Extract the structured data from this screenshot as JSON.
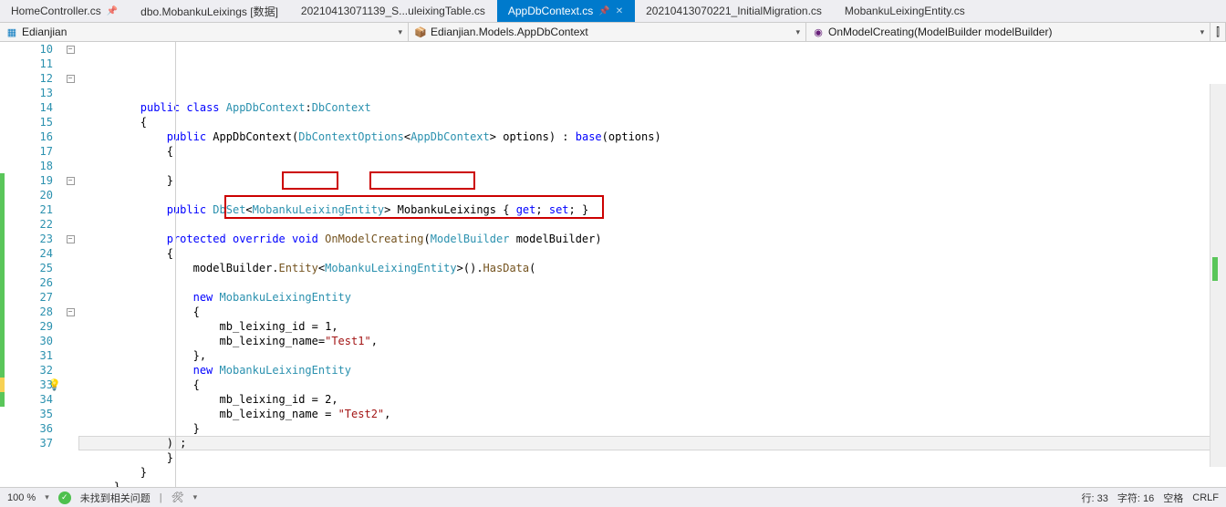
{
  "tabs": [
    {
      "label": "HomeController.cs",
      "pinned": true,
      "active": false
    },
    {
      "label": "dbo.MobankuLeixings [数据]",
      "pinned": false,
      "active": false
    },
    {
      "label": "20210413071139_S...uleixingTable.cs",
      "pinned": false,
      "active": false
    },
    {
      "label": "AppDbContext.cs",
      "pinned": true,
      "active": true
    },
    {
      "label": "20210413070221_InitialMigration.cs",
      "pinned": false,
      "active": false
    },
    {
      "label": "MobankuLeixingEntity.cs",
      "pinned": false,
      "active": false
    }
  ],
  "nav": {
    "project": "Edianjian",
    "type": "Edianjian.Models.AppDbContext",
    "member": "OnModelCreating(ModelBuilder modelBuilder)"
  },
  "lines": {
    "10": [
      [
        "kw",
        "public"
      ],
      [
        "",
        ""
      ],
      [
        "kw",
        "class"
      ],
      [
        "",
        ""
      ],
      [
        "type",
        "AppDbContext"
      ],
      [
        "punct",
        ":"
      ],
      [
        "type",
        "DbContext"
      ]
    ],
    "11": [
      [
        "punct",
        "{"
      ]
    ],
    "12": [
      [
        "kw",
        "public"
      ],
      [
        "",
        ""
      ],
      [
        "ident",
        "AppDbContext"
      ],
      [
        "punct",
        "("
      ],
      [
        "type",
        "DbContextOptions"
      ],
      [
        "punct",
        "<"
      ],
      [
        "type",
        "AppDbContext"
      ],
      [
        "punct",
        ">"
      ],
      [
        "",
        ""
      ],
      [
        "ident",
        "options"
      ],
      [
        "punct",
        ")"
      ],
      [
        "",
        ""
      ],
      [
        "punct",
        ":"
      ],
      [
        "",
        ""
      ],
      [
        "kw",
        "base"
      ],
      [
        "punct",
        "("
      ],
      [
        "ident",
        "options"
      ],
      [
        "punct",
        ")"
      ]
    ],
    "13": [
      [
        "punct",
        "{"
      ]
    ],
    "14": [],
    "15": [
      [
        "punct",
        "}"
      ]
    ],
    "16": [],
    "17": [
      [
        "kw",
        "public"
      ],
      [
        "",
        ""
      ],
      [
        "type",
        "DbSet"
      ],
      [
        "punct",
        "<"
      ],
      [
        "type",
        "MobankuLeixingEntity"
      ],
      [
        "punct",
        ">"
      ],
      [
        "",
        ""
      ],
      [
        "ident",
        "MobankuLeixings"
      ],
      [
        "",
        ""
      ],
      [
        "punct",
        "{"
      ],
      [
        "",
        ""
      ],
      [
        "kw",
        "get"
      ],
      [
        "punct",
        ";"
      ],
      [
        "",
        ""
      ],
      [
        "kw",
        "set"
      ],
      [
        "punct",
        ";"
      ],
      [
        "",
        ""
      ],
      [
        "punct",
        "}"
      ]
    ],
    "18": [],
    "19": [
      [
        "kw",
        "protected"
      ],
      [
        "",
        ""
      ],
      [
        "kw",
        "override"
      ],
      [
        "",
        ""
      ],
      [
        "kw",
        "void"
      ],
      [
        "",
        ""
      ],
      [
        "method",
        "OnModelCreating"
      ],
      [
        "punct",
        "("
      ],
      [
        "type",
        "ModelBuilder"
      ],
      [
        "",
        ""
      ],
      [
        "ident",
        "modelBuilder"
      ],
      [
        "punct",
        ")"
      ]
    ],
    "20": [
      [
        "punct",
        "{"
      ]
    ],
    "21": [
      [
        "ident",
        "modelBuilder"
      ],
      [
        "punct",
        "."
      ],
      [
        "method",
        "Entity"
      ],
      [
        "punct",
        "<"
      ],
      [
        "type",
        "MobankuLeixingEntity"
      ],
      [
        "punct",
        ">"
      ],
      [
        "punct",
        "()"
      ],
      [
        "punct",
        "."
      ],
      [
        "method",
        "HasData"
      ],
      [
        "punct",
        "("
      ]
    ],
    "22": [],
    "23": [
      [
        "kw",
        "new"
      ],
      [
        "",
        ""
      ],
      [
        "type",
        "MobankuLeixingEntity"
      ]
    ],
    "24": [
      [
        "punct",
        "{"
      ]
    ],
    "25": [
      [
        "ident",
        "mb_leixing_id"
      ],
      [
        "",
        ""
      ],
      [
        "punct",
        "="
      ],
      [
        "",
        ""
      ],
      [
        "num",
        "1"
      ],
      [
        "punct",
        ","
      ]
    ],
    "26": [
      [
        "ident",
        "mb_leixing_name"
      ],
      [
        "punct",
        "="
      ],
      [
        "str",
        "\"Test1\""
      ],
      [
        "punct",
        ","
      ]
    ],
    "27": [
      [
        "punct",
        "},"
      ]
    ],
    "28": [
      [
        "kw",
        "new"
      ],
      [
        "",
        ""
      ],
      [
        "type",
        "MobankuLeixingEntity"
      ]
    ],
    "29": [
      [
        "punct",
        "{"
      ]
    ],
    "30": [
      [
        "ident",
        "mb_leixing_id"
      ],
      [
        "",
        ""
      ],
      [
        "punct",
        "="
      ],
      [
        "",
        ""
      ],
      [
        "num",
        "2"
      ],
      [
        "punct",
        ","
      ]
    ],
    "31": [
      [
        "ident",
        "mb_leixing_name"
      ],
      [
        "",
        ""
      ],
      [
        "punct",
        "="
      ],
      [
        "",
        ""
      ],
      [
        "str",
        "\"Test2\""
      ],
      [
        "punct",
        ","
      ]
    ],
    "32": [
      [
        "punct",
        "}"
      ]
    ],
    "33": [
      [
        "punct",
        ") ;"
      ]
    ],
    "34": [
      [
        "punct",
        "}"
      ]
    ],
    "35": [
      [
        "punct",
        "}"
      ]
    ],
    "36": [
      [
        "punct",
        "}"
      ]
    ],
    "37": []
  },
  "indent": {
    "10": 2,
    "11": 2,
    "12": 3,
    "13": 3,
    "14": 0,
    "15": 3,
    "16": 0,
    "17": 3,
    "18": 0,
    "19": 3,
    "20": 3,
    "21": 4,
    "22": 0,
    "23": 4,
    "24": 4,
    "25": 5,
    "26": 5,
    "27": 4,
    "28": 4,
    "29": 4,
    "30": 5,
    "31": 5,
    "32": 4,
    "33": 3,
    "34": 3,
    "35": 2,
    "36": 1,
    "37": 0
  },
  "lineStart": 10,
  "lineEnd": 37,
  "currentLine": 33,
  "changeGreen": [
    19,
    20,
    21,
    22,
    23,
    24,
    25,
    26,
    27,
    28,
    29,
    30,
    31,
    32,
    33,
    34
  ],
  "changeYellow": [
    33
  ],
  "foldBoxes": {
    "10": true,
    "12": true,
    "19": true,
    "23": true,
    "28": true
  },
  "bulbLine": 33,
  "status": {
    "zoom": "100 %",
    "issues": "未找到相关问题",
    "line": "行: 33",
    "char": "字符: 16",
    "spaces": "空格",
    "eol": "CRLF"
  }
}
